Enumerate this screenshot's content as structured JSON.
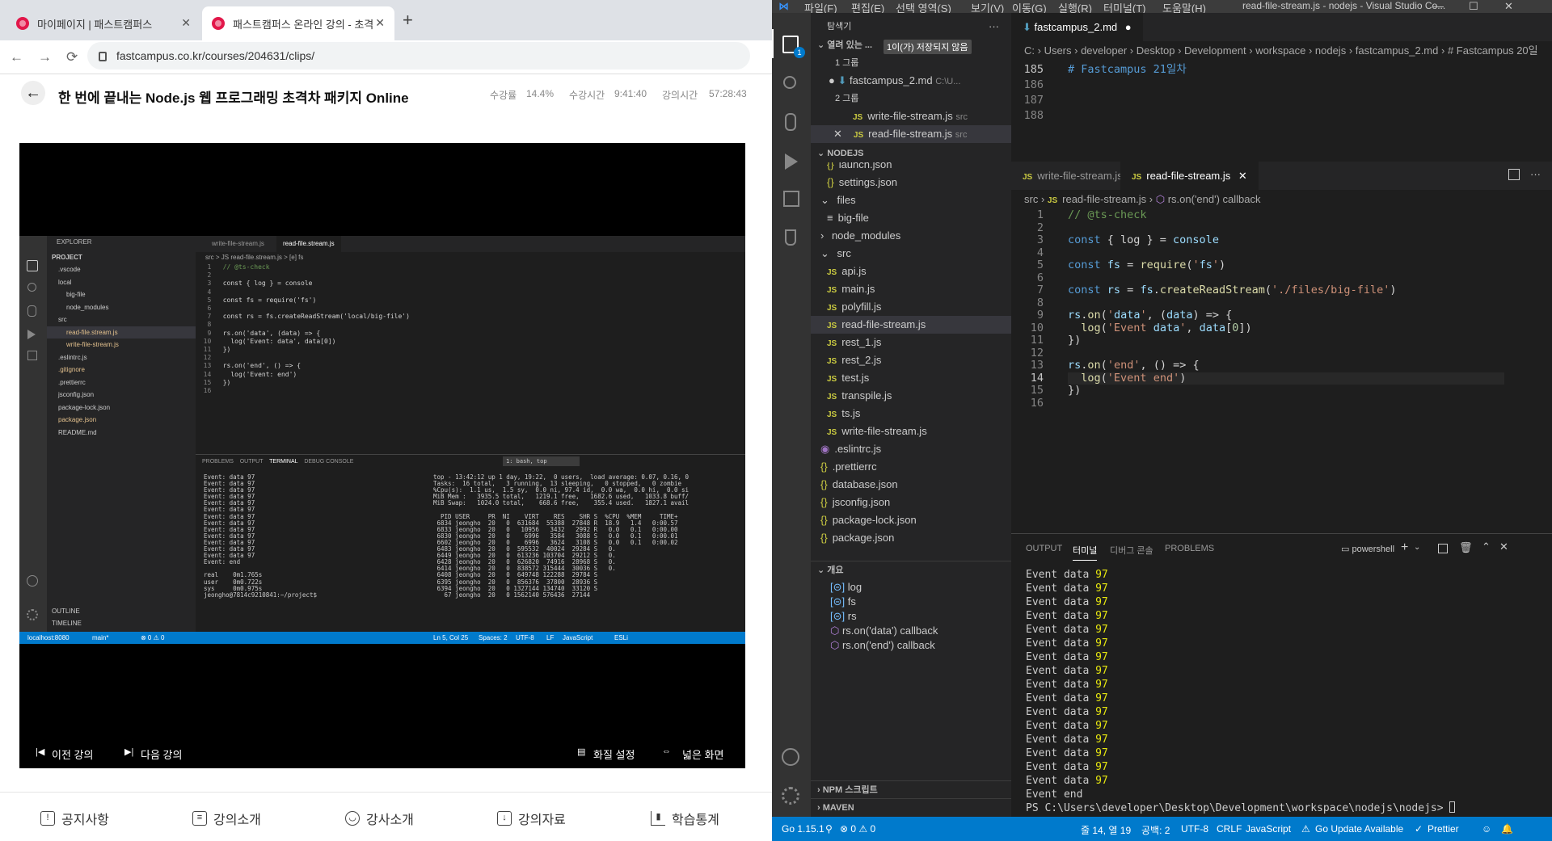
{
  "browser": {
    "tabs": [
      {
        "title": "마이페이지 | 패스트캠퍼스",
        "active": false
      },
      {
        "title": "패스트캠퍼스 온라인 강의 - 초격",
        "active": true
      }
    ],
    "url": "fastcampus.co.kr/courses/204631/clips/",
    "course_title": "한 번에 끝내는 Node.js 웹 프로그래밍 초격차 패키지 Online",
    "stats": {
      "progress_label": "수강률",
      "progress": "14.4%",
      "watch_label": "수강시간",
      "watch": "9:41:40",
      "lecture_label": "강의시간",
      "lecture": "57:28:43"
    },
    "player_controls": {
      "prev": "이전 강의",
      "next": "다음 강의",
      "quality": "화질 설정",
      "wide": "넓은 화면"
    },
    "bottom_nav": [
      "공지사항",
      "강의소개",
      "강사소개",
      "강의자료",
      "학습통계"
    ]
  },
  "video": {
    "explorer_title": "EXPLORER",
    "project_label": "PROJECT",
    "files": [
      ".vscode",
      "local",
      "big-file",
      "node_modules",
      "src",
      "read-file.stream.js",
      "write-file-stream.js",
      ".eslintrc.js",
      ".gitignore",
      ".prettierrc",
      "jsconfig.json",
      "package-lock.json",
      "package.json",
      "README.md"
    ],
    "outline": "OUTLINE",
    "timeline": "TIMELINE",
    "tabs": [
      "write-file-stream.js",
      "read-file.stream.js"
    ],
    "breadcrumb": "src > JS read-file.stream.js > [e] fs",
    "code": [
      "// @ts-check",
      "",
      "const { log } = console",
      "",
      "const fs = require('fs')",
      "",
      "const rs = fs.createReadStream('local/big-file')",
      "",
      "rs.on('data', (data) => {",
      "  log('Event: data', data[0])",
      "})",
      "",
      "rs.on('end', () => {",
      "  log('Event: end')",
      "})",
      ""
    ],
    "panel_tabs": [
      "PROBLEMS",
      "OUTPUT",
      "TERMINAL",
      "DEBUG CONSOLE"
    ],
    "terminal_select": "1: bash, top",
    "term_left": [
      "Event: data 97",
      "Event: data 97",
      "Event: data 97",
      "Event: data 97",
      "Event: data 97",
      "Event: data 97",
      "Event: data 97",
      "Event: data 97",
      "Event: data 97",
      "Event: data 97",
      "Event: data 97",
      "Event: data 97",
      "Event: data 97",
      "Event: end",
      "",
      "real\t0m1.765s",
      "user\t0m0.722s",
      "sys\t0m0.975s",
      "jeongho@7814c9210841:~/project$"
    ],
    "term_right": [
      "top - 13:42:12 up 1 day, 19:22,  0 users,  load average: 0.07, 0.16, 0",
      "Tasks:  16 total,   3 running,  13 sleeping,   0 stopped,   0 zombie",
      "%Cpu(s):  1.1 us,  1.5 sy,  0.0 ni, 97.4 id,  0.0 wa,  0.0 hi,  0.0 si",
      "MiB Mem :   3935.5 total,   1219.1 free,   1682.6 used,   1033.8 buff/",
      "MiB Swap:   1024.0 total,    668.6 free,    355.4 used.   1827.1 avail",
      "",
      "  PID USER     PR  NI    VIRT    RES    SHR S  %CPU  %MEM     TIME+",
      " 6834 jeongho  20   0  631684  55388  27848 R  18.9   1.4   0:00.57",
      " 6833 jeongho  20   0   10956   3432   2992 R   0.0   0.1   0:00.00",
      " 6830 jeongho  20   0    6996   3584   3088 S   0.0   0.1   0:00.01",
      " 6602 jeongho  20   0    6996   3624   3108 S   0.0   0.1   0:00.02",
      " 6483 jeongho  20   0  595532  40024  29284 S   0.",
      " 6449 jeongho  20   0  613236 103704  29212 S   0.",
      " 6428 jeongho  20   0  626820  74916  28968 S   0.",
      " 6414 jeongho  20   0  838572 315444  30036 S   0.",
      " 6408 jeongho  20   0  649748 122288  29784 S",
      " 6395 jeongho  20   0  856376  37800  28936 S",
      " 6394 jeongho  20   0 1327144 134740  33120 S",
      "   67 jeongho  20   0 1562140 576436  27144"
    ],
    "status_left": [
      "localhost:8080",
      "main*",
      "⊗ 0 ⚠ 0"
    ],
    "status_right": [
      "Ln 5, Col 25",
      "Spaces: 2",
      "UTF-8",
      "LF",
      "JavaScript",
      "ESLi"
    ]
  },
  "vscode": {
    "title": "read-file-stream.js - nodejs - Visual Studio Co...",
    "menu": [
      "파일(F)",
      "편집(E)",
      "선택 영역(S)",
      "보기(V)",
      "이동(G)",
      "실행(R)",
      "터미널(T)",
      "도움말(H)"
    ],
    "explorer_title": "탐색기",
    "open_editors_label": "열려 있는 ...",
    "unsaved_badge": "1이(가) 저장되지 않음",
    "group1": "1 그룹",
    "group1_file": "fastcampus_2.md",
    "group1_path": "C:\\U...",
    "group2": "2 그룹",
    "group2_files": [
      {
        "name": "write-file-stream.js",
        "dir": "src"
      },
      {
        "name": "read-file-stream.js",
        "dir": "src"
      }
    ],
    "workspace_label": "NODEJS",
    "tree": [
      {
        "name": "launch.json",
        "type": "json",
        "indent": 1
      },
      {
        "name": "settings.json",
        "type": "json",
        "indent": 1
      },
      {
        "name": "files",
        "type": "folder-open",
        "indent": 0
      },
      {
        "name": "big-file",
        "type": "file",
        "indent": 1
      },
      {
        "name": "node_modules",
        "type": "folder",
        "indent": 0
      },
      {
        "name": "src",
        "type": "folder-open",
        "indent": 0
      },
      {
        "name": "api.js",
        "type": "js",
        "indent": 1
      },
      {
        "name": "main.js",
        "type": "js",
        "indent": 1
      },
      {
        "name": "polyfill.js",
        "type": "js",
        "indent": 1
      },
      {
        "name": "read-file-stream.js",
        "type": "js",
        "indent": 1,
        "selected": true
      },
      {
        "name": "rest_1.js",
        "type": "js",
        "indent": 1
      },
      {
        "name": "rest_2.js",
        "type": "js",
        "indent": 1
      },
      {
        "name": "test.js",
        "type": "js",
        "indent": 1
      },
      {
        "name": "transpile.js",
        "type": "js",
        "indent": 1
      },
      {
        "name": "ts.js",
        "type": "js",
        "indent": 1
      },
      {
        "name": "write-file-stream.js",
        "type": "js",
        "indent": 1
      },
      {
        "name": ".eslintrc.js",
        "type": "eslint",
        "indent": 0
      },
      {
        "name": ".prettierrc",
        "type": "json",
        "indent": 0
      },
      {
        "name": "database.json",
        "type": "json",
        "indent": 0
      },
      {
        "name": "jsconfig.json",
        "type": "json",
        "indent": 0
      },
      {
        "name": "package-lock.json",
        "type": "json",
        "indent": 0
      },
      {
        "name": "package.json",
        "type": "json",
        "indent": 0
      }
    ],
    "outline_label": "개요",
    "outline": [
      "log",
      "fs",
      "rs",
      "rs.on('data') callback",
      "rs.on('end') callback"
    ],
    "npm_label": "NPM 스크립트",
    "maven_label": "MAVEN",
    "top_editor": {
      "tab": "fastcampus_2.md",
      "breadcrumb": [
        "C:",
        "Users",
        "developer",
        "Desktop",
        "Development",
        "workspace",
        "nodejs",
        "fastcampus_2.md",
        "# Fastcampus 20일"
      ],
      "lines": [
        {
          "n": "185",
          "t": "# Fastcampus 21일차"
        },
        {
          "n": "186",
          "t": ""
        },
        {
          "n": "187",
          "t": ""
        },
        {
          "n": "188",
          "t": ""
        }
      ]
    },
    "bottom_editor": {
      "tabs": [
        "write-file-stream.js",
        "read-file-stream.js"
      ],
      "breadcrumb": [
        "src",
        "read-file-stream.js",
        "rs.on('end') callback"
      ],
      "line_numbers": [
        "1",
        "2",
        "3",
        "4",
        "5",
        "6",
        "7",
        "8",
        "9",
        "10",
        "11",
        "12",
        "13",
        "14",
        "15",
        "16"
      ]
    },
    "panel_tabs": [
      "OUTPUT",
      "터미널",
      "디버그 콘솔",
      "PROBLEMS"
    ],
    "terminal_name": "powershell",
    "terminal_lines": [
      "Event data",
      "Event data",
      "Event data",
      "Event data",
      "Event data",
      "Event data",
      "Event data",
      "Event data",
      "Event data",
      "Event data",
      "Event data",
      "Event data",
      "Event data",
      "Event data",
      "Event data",
      "Event data"
    ],
    "terminal_value": "97",
    "terminal_end": "Event end",
    "prompt": "PS C:\\Users\\developer\\Desktop\\Development\\workspace\\nodejs\\nodejs> ",
    "status": {
      "go": "Go 1.15.1",
      "errors": "⊗ 0 ⚠ 0",
      "pos": "줄 14, 열 19",
      "spaces": "공백: 2",
      "enc": "UTF-8",
      "eol": "CRLF",
      "lang": "JavaScript",
      "go_update": "Go Update Available",
      "prettier": "Prettier"
    }
  }
}
